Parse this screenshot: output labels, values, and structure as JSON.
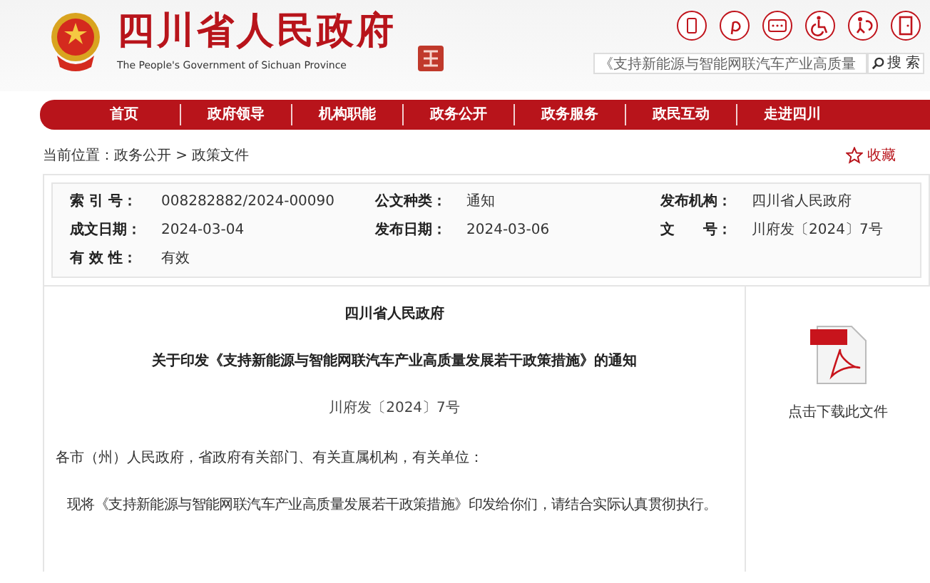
{
  "header": {
    "title": "四川省人民政府",
    "subtitle": "The People's Government of Sichuan Province",
    "search": {
      "value": "《支持新能源与智能网联汽车产业高质量",
      "button": "搜 索"
    }
  },
  "nav": [
    {
      "label": "首页"
    },
    {
      "label": "政府领导"
    },
    {
      "label": "机构职能"
    },
    {
      "label": "政务公开"
    },
    {
      "label": "政务服务"
    },
    {
      "label": "政民互动"
    },
    {
      "label": "走进四川"
    }
  ],
  "breadcrumb": "当前位置：政务公开 > 政策文件",
  "favorite": "收藏",
  "info": [
    {
      "label": "索 引 号：",
      "value": "008282882/2024-00090"
    },
    {
      "label": "公文种类：",
      "value": "通知"
    },
    {
      "label": "发布机构：",
      "value": "四川省人民政府"
    },
    {
      "label": "成文日期：",
      "value": "2024-03-04"
    },
    {
      "label": "发布日期：",
      "value": "2024-03-06"
    },
    {
      "label": "文　　号：",
      "value": "川府发〔2024〕7号"
    },
    {
      "label": "有 效 性：",
      "value": "有效"
    }
  ],
  "document": {
    "issuer": "四川省人民政府",
    "title": "关于印发《支持新能源与智能网联汽车产业高质量发展若干政策措施》的通知",
    "number": "川府发〔2024〕7号",
    "salutation": "各市（州）人民政府，省政府有关部门、有关直属机构，有关单位：",
    "paragraph": "现将《支持新能源与智能网联汽车产业高质量发展若干政策措施》印发给你们，请结合实际认真贯彻执行。"
  },
  "download": {
    "label": "点击下载此文件"
  }
}
